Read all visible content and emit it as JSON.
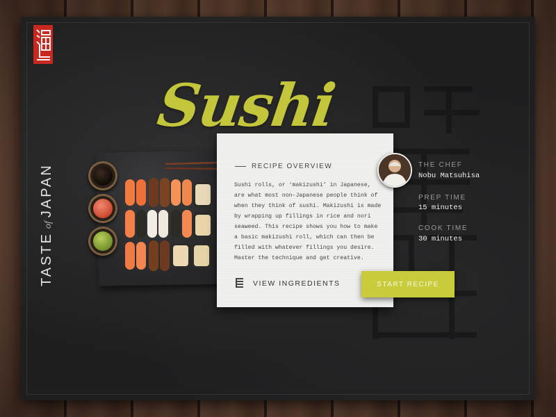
{
  "brand": {
    "side_title_pre": "TASTE",
    "side_title_of": "of",
    "side_title_post": "JAPAN",
    "logo_color": "#c8281f"
  },
  "dish": {
    "title": "Sushi",
    "title_color": "#c3c63a"
  },
  "overview": {
    "heading": "RECIPE OVERVIEW",
    "body": "Sushi rolls, or ‘makizushi’ in Japanese, are what most non-Japanese people think of when they think of sushi. Makizushi is made by wrapping up fillings in rice and nori seaweed. This recipe shows you how to make a basic makizushi roll, which can then be filled with whatever fillings you desire. Master the technique and get creative.",
    "view_ingredients_label": "VIEW INGREDIENTS",
    "view_ingredients_icon": "list-icon"
  },
  "actions": {
    "start_label": "START RECIPE",
    "accent_color": "#c9cc3a"
  },
  "meta": {
    "chef_label": "THE CHEF",
    "chef_name": "Nobu Matsuhisa",
    "prep_label": "PREP TIME",
    "prep_value": "15 minutes",
    "cook_label": "COOK TIME",
    "cook_value": "30 minutes"
  }
}
